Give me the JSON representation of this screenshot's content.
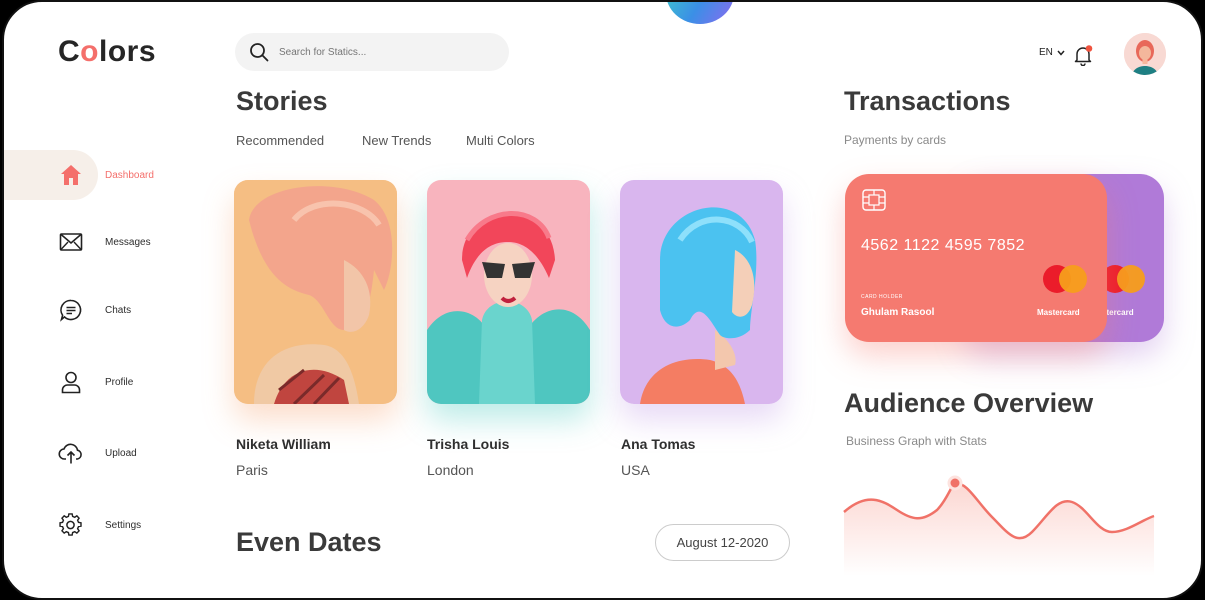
{
  "brand": {
    "logo_pre": "C",
    "logo_o": "o",
    "logo_post": "lors"
  },
  "sidebar": {
    "items": [
      {
        "label": "Dashboard",
        "icon": "home-icon",
        "active": true
      },
      {
        "label": "Messages",
        "icon": "mail-icon"
      },
      {
        "label": "Chats",
        "icon": "chat-icon"
      },
      {
        "label": "Profile",
        "icon": "user-icon"
      },
      {
        "label": "Upload",
        "icon": "cloud-upload-icon"
      },
      {
        "label": "Settings",
        "icon": "gear-icon"
      }
    ]
  },
  "header": {
    "search_placeholder": "Search for Statics...",
    "language": "EN"
  },
  "stories": {
    "title": "Stories",
    "tabs": [
      "Recommended",
      "New Trends",
      "Multi Colors"
    ],
    "cards": [
      {
        "name": "Niketa William",
        "city": "Paris"
      },
      {
        "name": "Trisha Louis",
        "city": "London"
      },
      {
        "name": "Ana Tomas",
        "city": "USA"
      }
    ]
  },
  "events": {
    "title": "Even Dates",
    "date": "August 12-2020"
  },
  "transactions": {
    "title": "Transactions",
    "subtitle": "Payments by cards",
    "card": {
      "number": "4562 1122 4595 7852",
      "holder_label": "CARD HOLDER",
      "holder": "Ghulam Rasool",
      "brand": "Mastercard",
      "back_brand": "stercard"
    }
  },
  "audience": {
    "title": "Audience Overview",
    "subtitle": "Business Graph with Stats"
  },
  "colors": {
    "accent": "#f46f6b",
    "card_front": "#f57a70",
    "card_back": "#b07ad8"
  }
}
